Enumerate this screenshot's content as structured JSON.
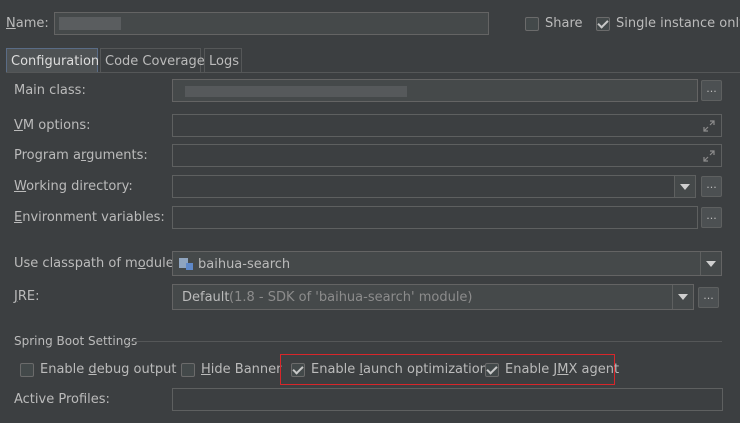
{
  "header": {
    "name_label": "Name:",
    "name_value": "",
    "share_label": "Share",
    "share_checked": false,
    "single_instance_label": "Single instance only",
    "single_instance_checked": true
  },
  "tabs": [
    {
      "label": "Configuration",
      "active": true
    },
    {
      "label": "Code Coverage",
      "active": false
    },
    {
      "label": "Logs",
      "active": false
    }
  ],
  "form": {
    "main_class_label": "Main class:",
    "main_class_value": "",
    "vm_options_label": "VM options:",
    "vm_options_value": "",
    "program_arguments_label": "Program arguments:",
    "program_arguments_value": "",
    "working_directory_label": "Working directory:",
    "working_directory_value": "",
    "env_vars_label": "Environment variables:",
    "env_vars_value": "",
    "classpath_label": "Use classpath of module:",
    "classpath_value": "baihua-search",
    "jre_label": "JRE:",
    "jre_value": "Default",
    "jre_detail": "(1.8 - SDK of 'baihua-search' module)",
    "browse_button": "..."
  },
  "spring_boot": {
    "section_title": "Spring Boot Settings",
    "enable_debug_label": "Enable debug output",
    "enable_debug_checked": false,
    "hide_banner_label": "Hide Banner",
    "hide_banner_checked": false,
    "launch_opt_label": "Enable launch optimization",
    "launch_opt_checked": true,
    "jmx_label": "Enable JMX agent",
    "jmx_checked": true,
    "active_profiles_label": "Active Profiles:",
    "active_profiles_value": ""
  },
  "colors": {
    "background": "#3c3f41",
    "field_background": "#45494a",
    "text": "#bbbbbb",
    "highlight_border": "#d8262a",
    "active_tab_border": "#5a6c86"
  }
}
